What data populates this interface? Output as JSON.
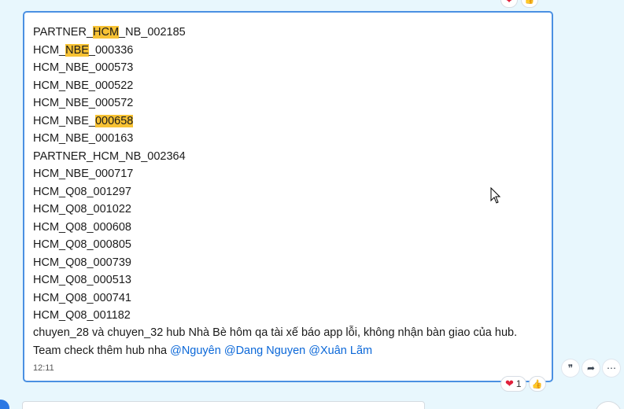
{
  "message": {
    "lines": [
      {
        "segments": [
          {
            "t": "PARTNER_",
            "hl": false
          },
          {
            "t": "HCM",
            "hl": true
          },
          {
            "t": "_NB_002185",
            "hl": false
          }
        ]
      },
      {
        "segments": [
          {
            "t": "HCM_",
            "hl": false
          },
          {
            "t": "NBE",
            "hl": true
          },
          {
            "t": "_000336",
            "hl": false
          }
        ]
      },
      {
        "segments": [
          {
            "t": "HCM_NBE_000573",
            "hl": false
          }
        ]
      },
      {
        "segments": [
          {
            "t": "HCM_NBE_000522",
            "hl": false
          }
        ]
      },
      {
        "segments": [
          {
            "t": "HCM_NBE_000572",
            "hl": false
          }
        ]
      },
      {
        "segments": [
          {
            "t": "HCM_NBE_",
            "hl": false
          },
          {
            "t": "000658",
            "hl": true
          }
        ]
      },
      {
        "segments": [
          {
            "t": "HCM_NBE_000163",
            "hl": false
          }
        ]
      },
      {
        "segments": [
          {
            "t": "PARTNER_HCM_NB_002364",
            "hl": false
          }
        ]
      },
      {
        "segments": [
          {
            "t": "HCM_NBE_000717",
            "hl": false
          }
        ]
      },
      {
        "segments": [
          {
            "t": "HCM_Q08_001297",
            "hl": false
          }
        ]
      },
      {
        "segments": [
          {
            "t": "HCM_Q08_001022",
            "hl": false
          }
        ]
      },
      {
        "segments": [
          {
            "t": "HCM_Q08_000608",
            "hl": false
          }
        ]
      },
      {
        "segments": [
          {
            "t": "HCM_Q08_000805",
            "hl": false
          }
        ]
      },
      {
        "segments": [
          {
            "t": "HCM_Q08_000739",
            "hl": false
          }
        ]
      },
      {
        "segments": [
          {
            "t": "HCM_Q08_000513",
            "hl": false
          }
        ]
      },
      {
        "segments": [
          {
            "t": "HCM_Q08_000741",
            "hl": false
          }
        ]
      },
      {
        "segments": [
          {
            "t": "HCM_Q08_001182",
            "hl": false
          }
        ]
      }
    ],
    "text_line_1": "chuyen_28 và chuyen_32 hub Nhà Bè hôm qa tài xế báo app lỗi, không nhận bàn giao của hub.",
    "text_line_2_prefix": "Team check thêm hub nha ",
    "mentions": [
      "@Nguyên",
      "@Dang Nguyen",
      "@Xuân Lãm"
    ],
    "time": "12:11"
  },
  "reactions": {
    "heart_icon": "❤",
    "heart_count": "1",
    "like_icon": "👍"
  },
  "actions": {
    "quote_icon": "❞",
    "forward_icon": "➦",
    "more_icon": "⋯"
  },
  "colors": {
    "background": "#e8f7fd",
    "bubble_border": "#4a90e2",
    "highlight": "#f7c234",
    "mention": "#0a67d8"
  }
}
